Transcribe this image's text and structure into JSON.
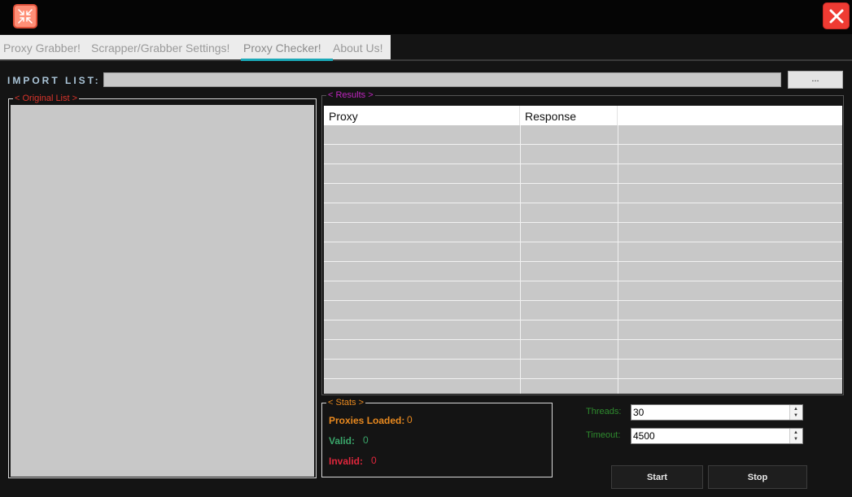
{
  "titlebar": {
    "app_icon": "compress-arrows-icon",
    "close_icon": "close-icon",
    "colors": {
      "app_icon_bg": "#ff8f77",
      "close_bg": "#ef3b33"
    }
  },
  "tabs": [
    {
      "label": "Proxy Grabber!"
    },
    {
      "label": "Scrapper/Grabber Settings!"
    },
    {
      "label": "Proxy Checker!"
    },
    {
      "label": "About Us!"
    }
  ],
  "active_tab": "Proxy Checker!",
  "import": {
    "label": "IMPORT LIST:",
    "value": "",
    "browse_label": "..."
  },
  "original_list": {
    "legend": "< Original List >",
    "items": []
  },
  "results": {
    "legend": "< Results >",
    "columns": [
      "Proxy",
      "Response",
      ""
    ],
    "rows": []
  },
  "stats": {
    "legend": "< Stats >",
    "proxies_loaded_label": "Proxies Loaded:",
    "proxies_loaded_value": "0",
    "valid_label": "Valid:",
    "valid_value": "0",
    "invalid_label": "Invalid:",
    "invalid_value": "0",
    "colors": {
      "loaded": "#e8891f",
      "valid": "#3aa56a",
      "invalid": "#e0263c"
    }
  },
  "settings": {
    "threads_label": "Threads:",
    "threads_value": "30",
    "timeout_label": "Timeout:",
    "timeout_value": "4500"
  },
  "buttons": {
    "start_label": "Start",
    "stop_label": "Stop"
  }
}
